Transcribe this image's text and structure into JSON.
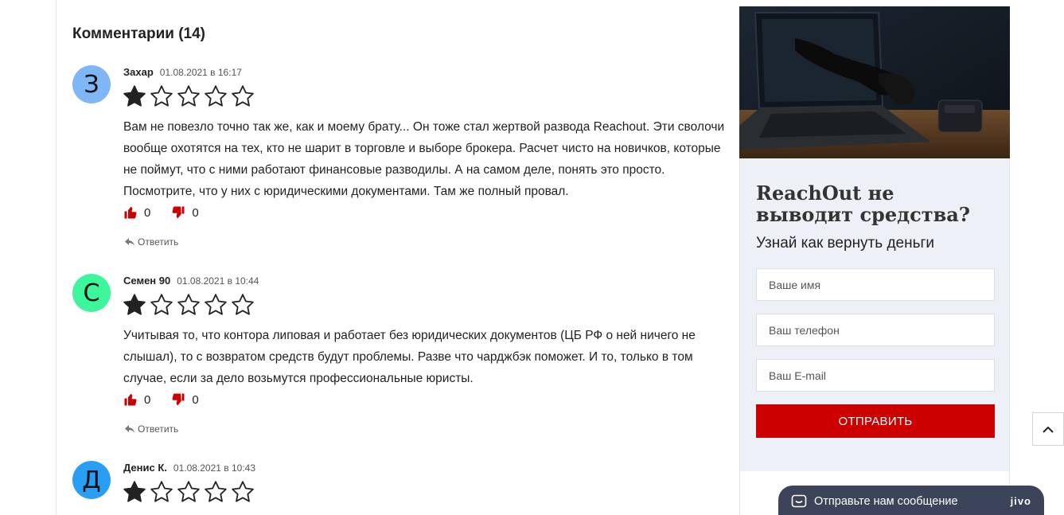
{
  "comments_title": "Комментарии (14)",
  "comments": [
    {
      "avatar_letter": "З",
      "avatar_color": "#7fb6f5",
      "author": "Захар",
      "date": "01.08.2021 в 16:17",
      "rating": 1,
      "max_rating": 5,
      "text": "Вам не повезло точно так же, как и моему брату... Он тоже стал жертвой развода Reachout. Эти сволочи вообще охотятся на тех, кто не шарит в торговле и выборе брокера. Расчет чисто на новичков, которые не поймут, что с ними работают финансовые разводилы. А на самом деле, понять это просто. Посмотрите, что у них с юридическими документами. Там же полный провал.",
      "likes": "0",
      "dislikes": "0",
      "reply_label": "Ответить"
    },
    {
      "avatar_letter": "С",
      "avatar_color": "#3df59a",
      "author": "Семен 90",
      "date": "01.08.2021 в 10:44",
      "rating": 1,
      "max_rating": 5,
      "text": "Учитывая то, что контора липовая и работает без юридических документов (ЦБ РФ о ней ничего не слышал), то с возвратом средств будут проблемы. Разве что чарджбэк поможет. И то, только в том случае, если за дело возьмутся профессиональные юристы.",
      "likes": "0",
      "dislikes": "0",
      "reply_label": "Ответить"
    },
    {
      "avatar_letter": "Д",
      "avatar_color": "#2a9df4",
      "author": "Денис К.",
      "date": "01.08.2021 в 10:43",
      "rating": 1,
      "max_rating": 5
    }
  ],
  "sidebar_form": {
    "title": "ReachOut не выводит средства?",
    "subtitle": "Узнай как вернуть деньги",
    "name_placeholder": "Ваше имя",
    "phone_placeholder": "Ваш телефон",
    "email_placeholder": "Ваш E-mail",
    "submit_label": "ОТПРАВИТЬ",
    "accent_color": "#cc0000"
  },
  "chat_widget": {
    "label": "Отправьте нам сообщение",
    "brand": "jivo"
  },
  "icons": {
    "like": "thumbs-up-icon",
    "dislike": "thumbs-down-icon",
    "reply": "reply-arrow-icon",
    "scroll_top": "chevron-up-icon",
    "chat": "message-icon"
  }
}
